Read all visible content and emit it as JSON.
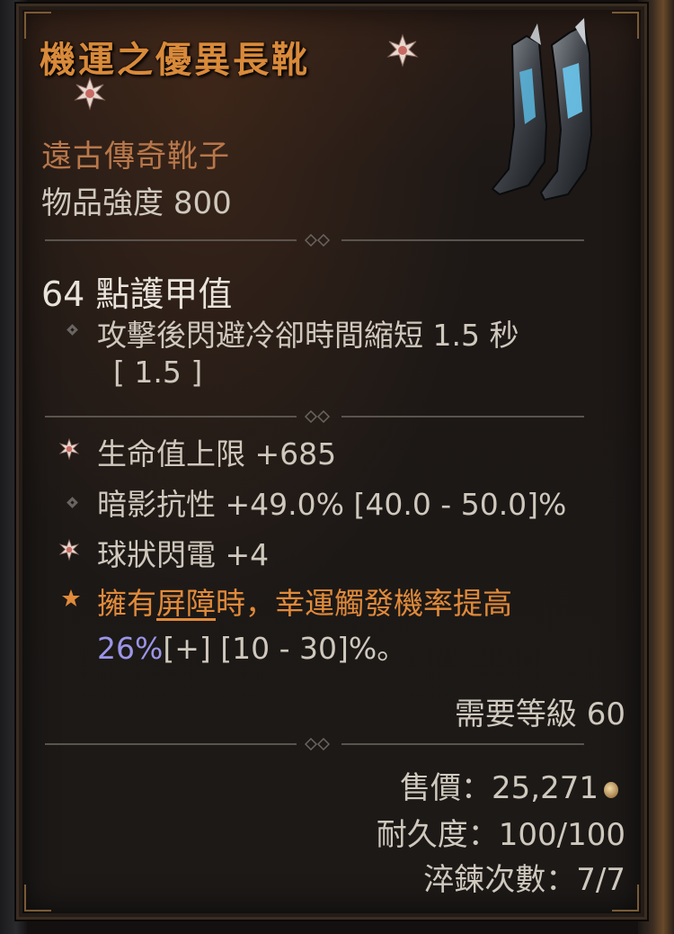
{
  "item": {
    "name": "機運之優異長靴",
    "type": "遠古傳奇靴子",
    "power_label": "物品強度",
    "power_value": "800",
    "armor": "64 點護甲值",
    "implicit_line1": "攻擊後閃避冷卻時間縮短 1.5 秒",
    "implicit_line2": "[ 1.5 ]",
    "affixes": [
      {
        "text": "生命值上限 +685",
        "icon": "greater-affix-icon"
      },
      {
        "text": "暗影抗性 +49.0% [40.0 - 50.0]%",
        "icon": "diamond-bullet-icon"
      },
      {
        "text": "球狀閃電 +4",
        "icon": "greater-affix-icon"
      }
    ],
    "aspect": {
      "part1": "擁有",
      "underlined": "屏障",
      "part2": "時，幸運觸發機率提高",
      "value": "26%",
      "suffix": "[+] [10 - 30]%。",
      "icon": "star-icon"
    },
    "required_level": "需要等級 60",
    "sell_price": "售價：25,271",
    "durability": "耐久度：100/100",
    "temper_count": "淬鍊次數：7/7"
  },
  "colors": {
    "title": "#d98a3a",
    "type": "#b8774a",
    "stat": "#cfc8bd",
    "aspect": "#e08a3a",
    "aspect_value": "#9b95e8"
  }
}
